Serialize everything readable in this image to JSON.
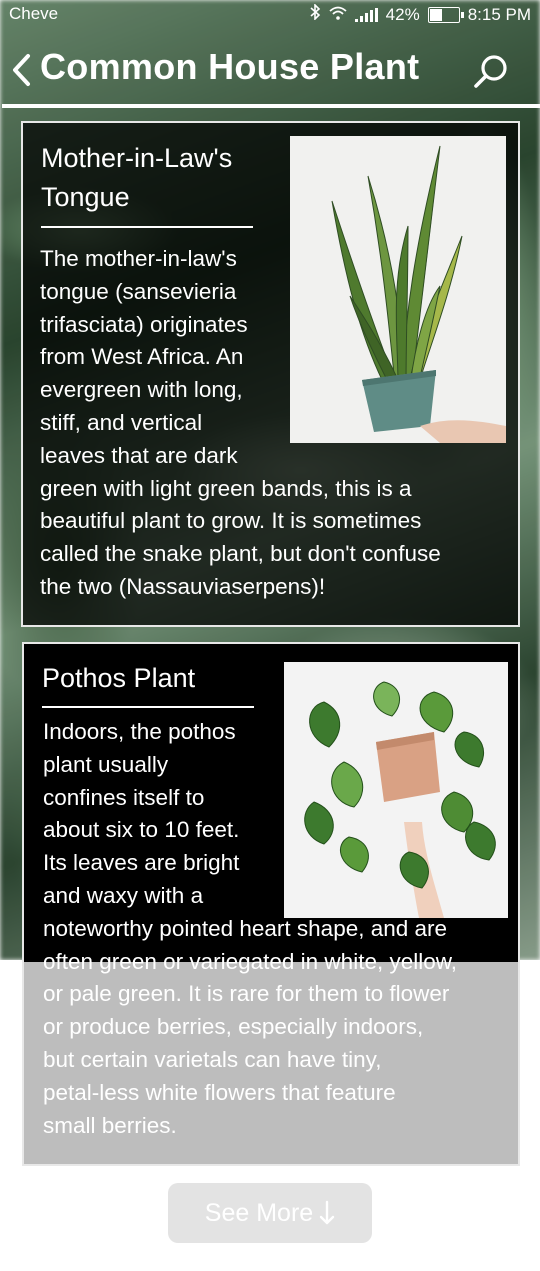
{
  "status_bar": {
    "carrier": "Cheve",
    "battery": "42%",
    "battery_level": 0.42,
    "time": "8:15 PM"
  },
  "header": {
    "title": "Common House Plant",
    "back_icon": "chevron-left-icon",
    "search_icon": "search-icon"
  },
  "plants": [
    {
      "name_line1": "Mother-in-Law's",
      "name_line2": "Tongue",
      "image_icon": "snake-plant-photo",
      "description_lines": [
        "The mother-in-law's",
        "tongue (sansevieria",
        "trifasciata) originates",
        "from West Africa. An",
        "evergreen with long,",
        "stiff, and vertical",
        "leaves that are dark",
        "green with light green bands, this is a",
        "beautiful plant to grow. It is sometimes",
        "called the snake plant, but don't confuse",
        "the two (Nassauviaserpens)!"
      ]
    },
    {
      "name_line1": "Pothos Plant",
      "image_icon": "pothos-plant-photo",
      "description_lines": [
        "Indoors, the pothos",
        "plant usually",
        "confines itself to",
        "about six to 10 feet.",
        "Its leaves are bright",
        "and waxy with a",
        "noteworthy pointed heart shape, and are",
        "often green or variegated in white, yellow,",
        "or pale green. It is rare for them to flower",
        "or produce berries, especially indoors,",
        "but certain varietals can have tiny,",
        "petal-less white flowers that feature",
        "small berries."
      ]
    }
  ],
  "see_more": {
    "label": "See More",
    "icon": "arrow-down-icon"
  },
  "colors": {
    "card_border": "#e8e8e8",
    "text": "#ffffff",
    "button_bg": "#e3e3e3"
  }
}
